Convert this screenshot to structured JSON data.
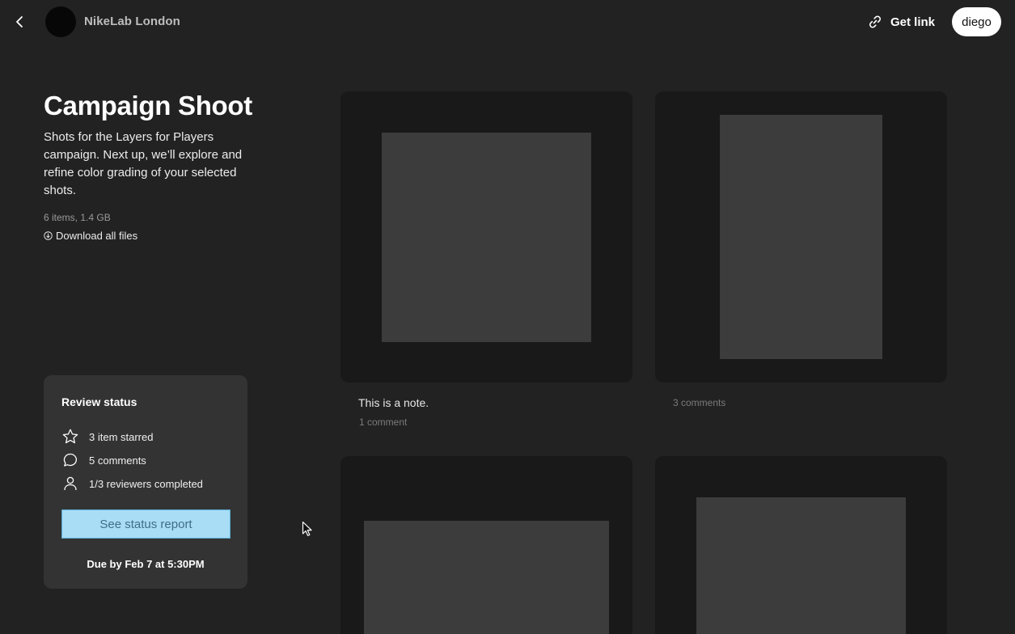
{
  "header": {
    "back_icon": "chevron-left-icon",
    "org_name": "NikeLab London",
    "get_link_label": "Get link",
    "link_icon": "link-icon",
    "user_label": "diego"
  },
  "project": {
    "title": "Campaign Shoot",
    "description": "Shots for the Layers for Players campaign. Next up, we’ll explore and refine color grading of your selected shots.",
    "meta": "6 items, 1.4 GB",
    "download_label": "Download all files",
    "download_icon": "download-icon"
  },
  "review": {
    "title": "Review status",
    "stats": [
      {
        "icon": "star-icon",
        "label": "3 item starred"
      },
      {
        "icon": "comment-icon",
        "label": "5 comments"
      },
      {
        "icon": "person-icon",
        "label": "1/3 reviewers completed"
      }
    ],
    "button_label": "See status report",
    "due": "Due by Feb 7 at 5:30PM"
  },
  "items": [
    {
      "note": "This is a note.",
      "comments": "1 comment"
    },
    {
      "note": "",
      "comments": "3 comments"
    },
    {
      "note": "",
      "comments": ""
    },
    {
      "note": "",
      "comments": ""
    }
  ],
  "colors": {
    "background": "#222222",
    "card": "#181918",
    "thumbnail": "#3c3c3c",
    "panel": "#333333",
    "accent_button": "#a9dcf5"
  }
}
